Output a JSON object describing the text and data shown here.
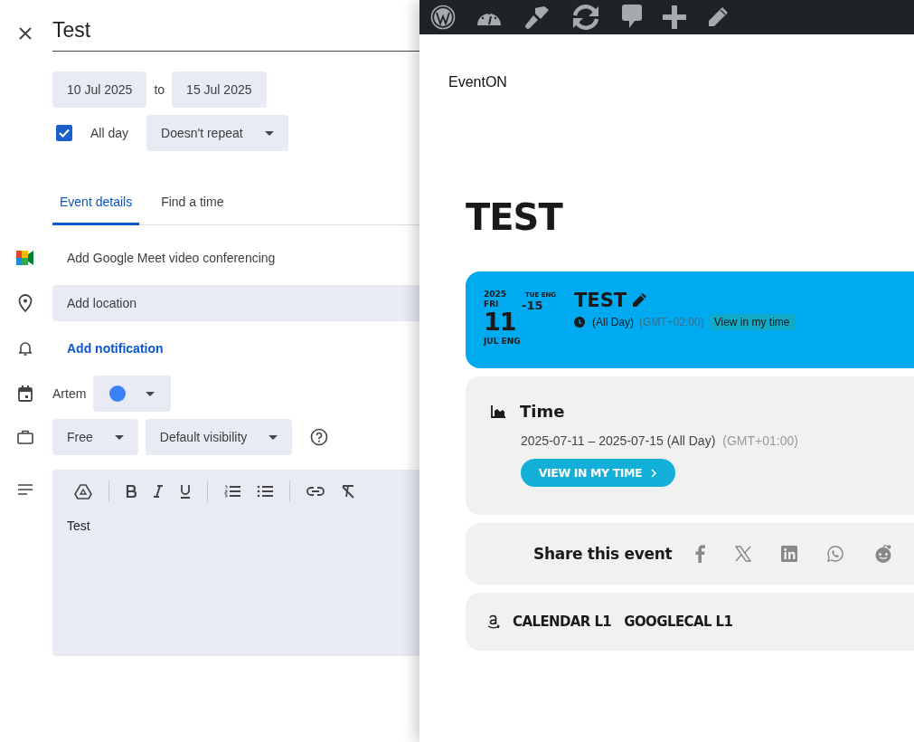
{
  "editor": {
    "title": "Test",
    "start_date": "10 Jul 2025",
    "to": "to",
    "end_date": "15 Jul 2025",
    "all_day": {
      "label": "All day",
      "checked": true
    },
    "repeat": "Doesn't repeat",
    "tabs": [
      {
        "label": "Event details",
        "selected": true
      },
      {
        "label": "Find a time",
        "selected": false
      }
    ],
    "meet": "Add Google Meet video conferencing",
    "location": {
      "placeholder": "Add location"
    },
    "notification": "Add notification",
    "calendar": {
      "owner": "Artem",
      "color": "#3b82f6"
    },
    "availability": "Free",
    "visibility": "Default visibility",
    "description": "Test"
  },
  "site": {
    "brand": "EventON",
    "heading": "TEST",
    "event": {
      "year": "2025",
      "day_name": "FRI",
      "day": "11",
      "month": "JUL ENG",
      "end_day_name": "TUE ENG",
      "end_day": "-15",
      "title": "TEST",
      "all_day": "(All Day)",
      "timezone": "(GMT+02:00)",
      "view_link": "View in my time"
    },
    "time_card": {
      "title": "Time",
      "range": "2025-07-11 – 2025-07-15 (All Day)",
      "timezone": "(GMT+01:00)",
      "button": "VIEW IN MY TIME"
    },
    "share_label": "Share this event",
    "categories": [
      "CALENDAR L1",
      "GOOGLECAL L1"
    ]
  }
}
